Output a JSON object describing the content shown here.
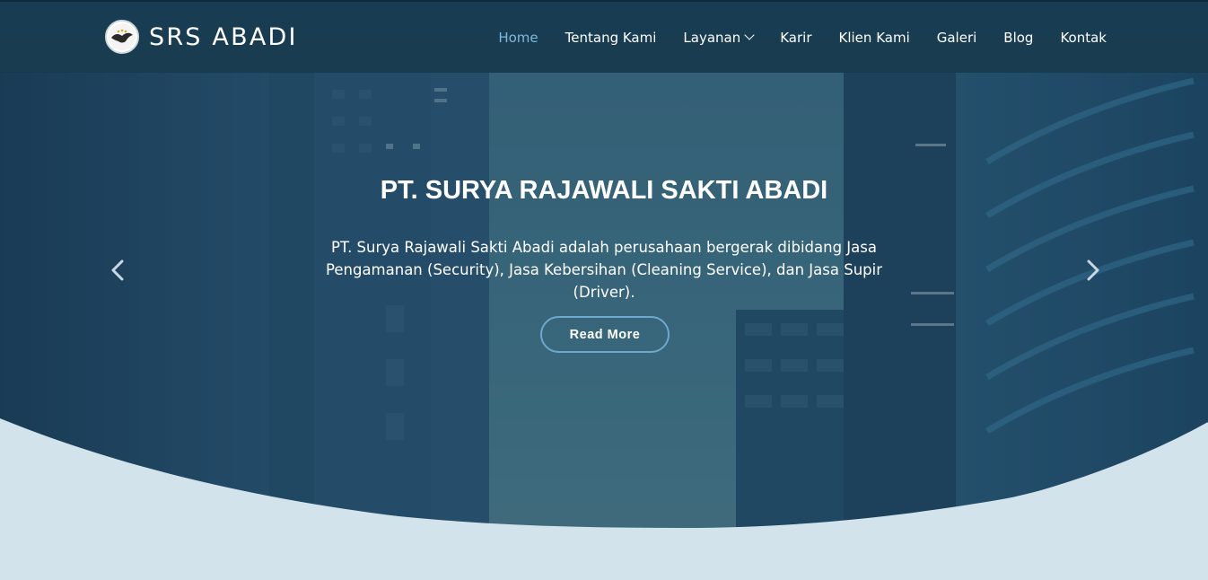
{
  "header": {
    "logo_text": "SRS ABADI",
    "nav": [
      {
        "label": "Home",
        "active": true
      },
      {
        "label": "Tentang Kami"
      },
      {
        "label": "Layanan",
        "has_dropdown": true
      },
      {
        "label": "Karir"
      },
      {
        "label": "Klien Kami"
      },
      {
        "label": "Galeri"
      },
      {
        "label": "Blog"
      },
      {
        "label": "Kontak"
      }
    ]
  },
  "hero": {
    "title": "PT. SURYA RAJAWALI SAKTI ABADI",
    "description": "PT. Surya Rajawali Sakti Abadi adalah perusahaan bergerak dibidang Jasa Pengamanan (Security), Jasa Kebersihan (Cleaning Service), dan Jasa Supir (Driver).",
    "button_label": "Read More",
    "prev_icon": "chevron-left-icon",
    "next_icon": "chevron-right-icon"
  },
  "colors": {
    "header_bg": "#17394e",
    "nav_active": "#7fb8de",
    "button_border": "#6fa8cf",
    "wave_light": "#d2e3ec"
  }
}
